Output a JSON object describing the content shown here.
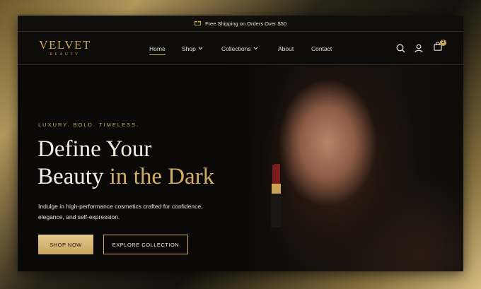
{
  "announcement": {
    "text": "Free Shipping on Orders Over $50",
    "icon": "gift-icon"
  },
  "brand": {
    "name": "VELVET",
    "subtitle": "BEAUTY"
  },
  "nav": {
    "items": [
      {
        "label": "Home",
        "active": true
      },
      {
        "label": "Shop",
        "has_dropdown": true
      },
      {
        "label": "Collections",
        "has_dropdown": true
      },
      {
        "label": "About"
      },
      {
        "label": "Contact"
      }
    ],
    "cart_count": "2",
    "icons": [
      "search-icon",
      "user-icon",
      "bag-icon"
    ]
  },
  "hero": {
    "tagline": "LUXURY. BOLD. TIMELESS.",
    "headline_line1": "Define Your",
    "headline_line2_white": "Beauty",
    "headline_line2_gold": "in the Dark",
    "description": "Indulge in high-performance cosmetics crafted for confidence, elegance, and self-expression.",
    "primary_cta": "SHOP NOW",
    "secondary_cta": "EXPLORE COLLECTION"
  },
  "colors": {
    "gold": "#c9a55a",
    "background": "#0b0a08",
    "text": "#f3eee2"
  }
}
